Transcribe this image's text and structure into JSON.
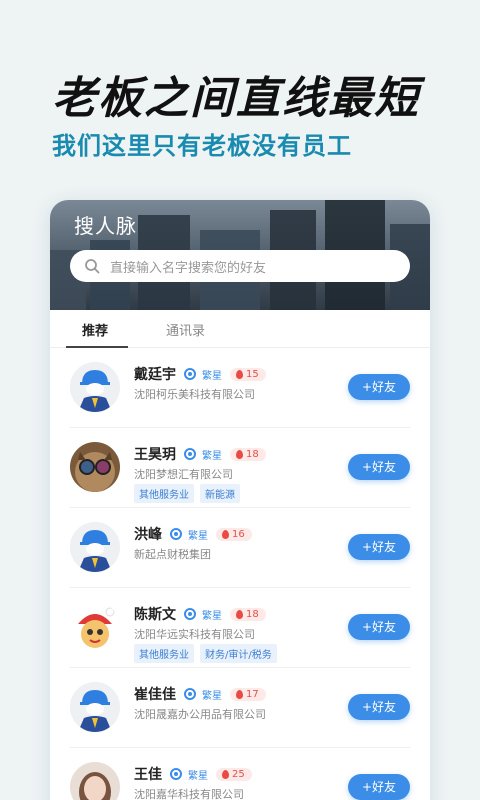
{
  "headline": "老板之间直线最短",
  "subline": "我们这里只有老板没有员工",
  "app": {
    "title": "搜人脉",
    "search_placeholder": "直接输入名字搜索您的好友",
    "tabs": [
      {
        "label": "推荐",
        "active": true
      },
      {
        "label": "通讯录",
        "active": false
      }
    ]
  },
  "colors": {
    "accent": "#3b8de8",
    "headline_sub": "#1a8bb0",
    "tag_bg": "#e8f1fc",
    "fire": "#e84b43"
  },
  "people": [
    {
      "name": "戴廷宇",
      "level": "繁星",
      "score": "15",
      "company": "沈阳柯乐美科技有限公司",
      "tags": [],
      "avatar": "default-avatar-icon",
      "button": "+好友"
    },
    {
      "name": "王昊玥",
      "level": "繁星",
      "score": "18",
      "company": "沈阳梦想汇有限公司",
      "tags": [
        "其他服务业",
        "新能源"
      ],
      "avatar": "cat-photo",
      "button": "+好友"
    },
    {
      "name": "洪峰",
      "level": "繁星",
      "score": "16",
      "company": "新起点财税集团",
      "tags": [],
      "avatar": "default-avatar-icon",
      "button": "+好友"
    },
    {
      "name": "陈斯文",
      "level": "繁星",
      "score": "18",
      "company": "沈阳华远实科技有限公司",
      "tags": [
        "其他服务业",
        "财务/审计/税务"
      ],
      "avatar": "cartoon-avatar",
      "button": "+好友"
    },
    {
      "name": "崔佳佳",
      "level": "繁星",
      "score": "17",
      "company": "沈阳晟嘉办公用品有限公司",
      "tags": [],
      "avatar": "default-avatar-icon",
      "button": "+好友"
    },
    {
      "name": "王佳",
      "level": "繁星",
      "score": "25",
      "company": "沈阳嘉华科技有限公司",
      "tags": [],
      "avatar": "woman-photo",
      "button": "+好友"
    }
  ]
}
